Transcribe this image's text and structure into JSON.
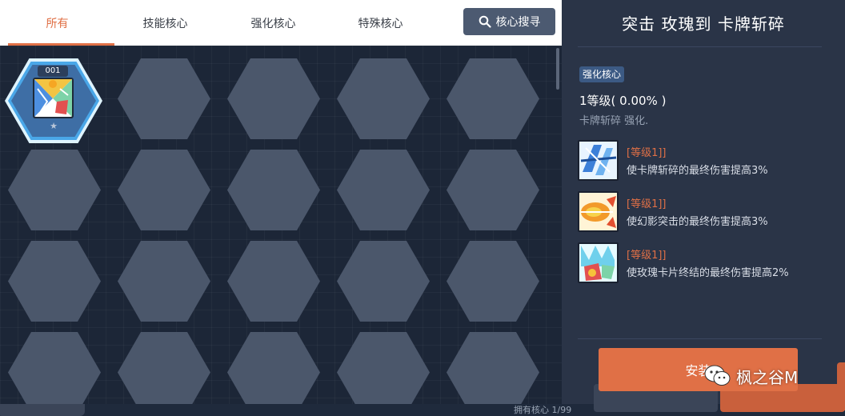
{
  "tabs": [
    {
      "label": "所有",
      "active": true
    },
    {
      "label": "技能核心",
      "active": false
    },
    {
      "label": "强化核心",
      "active": false
    },
    {
      "label": "特殊核心",
      "active": false
    }
  ],
  "search": {
    "label": "核心搜寻",
    "icon": "search-icon"
  },
  "grid": {
    "selected_core": {
      "number": "001",
      "icon": "card-core-icon",
      "star": "★"
    }
  },
  "owned": {
    "label": "拥有核心 1/99"
  },
  "detail": {
    "title": "突击 玫瑰到 卡牌斩碎",
    "type_tag": "强化核心",
    "level": "1等级( 0.00% )",
    "description": "卡牌斩碎 强化.",
    "effects": [
      {
        "icon": "card-slash-icon",
        "level": "[等级1]]",
        "text": "使卡牌斩碎的最终伤害提高3%"
      },
      {
        "icon": "phantom-strike-icon",
        "level": "[等级1]]",
        "text": "使幻影突击的最终伤害提高3%"
      },
      {
        "icon": "rose-card-finale-icon",
        "level": "[等级1]]",
        "text": "使玫瑰卡片终结的最终伤害提高2%"
      }
    ],
    "equip_label": "安装"
  },
  "watermark": {
    "text": "枫之谷M"
  },
  "colors": {
    "accent": "#e07046",
    "panel_bg": "#2a3447",
    "grid_bg": "#1c2637",
    "hex_fill": "#4b576b",
    "tag_bg": "#3c5a84"
  }
}
